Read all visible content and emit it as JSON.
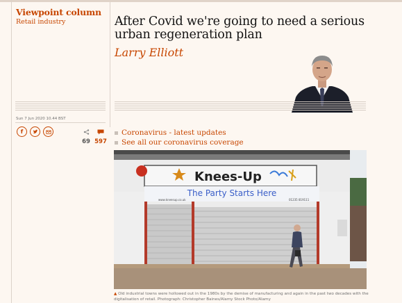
{
  "article": {
    "series": "Viewpoint column",
    "section": "Retail industry",
    "headline": "After Covid we're going to need a serious urban regeneration plan",
    "byline": "Larry Elliott",
    "date": "Sun 7 Jun 2020 10.44 BST"
  },
  "share": {
    "buttons": [
      {
        "icon": "facebook-icon",
        "glyph": "f"
      },
      {
        "icon": "twitter-icon"
      },
      {
        "icon": "email-icon"
      }
    ],
    "share_count": "69",
    "comment_count": "597"
  },
  "related": [
    "Coronavirus - latest updates",
    "See all our coronavirus coverage"
  ],
  "photo": {
    "shop_name": "Knees-Up",
    "tagline": "The Party Starts Here",
    "web": "www.kneesup.co.uk",
    "phone": "01235 819111",
    "caption": "Old industrial towns were hollowed out in the 1980s by the demise of manufacturing and again in the past two decades with the digitalisation of retail. Photograph: Christopher Baines/Alamy Stock Photo/Alamy"
  },
  "colors": {
    "accent": "#c74600",
    "background": "#fdf7f1",
    "text": "#121212",
    "muted": "#707070"
  }
}
